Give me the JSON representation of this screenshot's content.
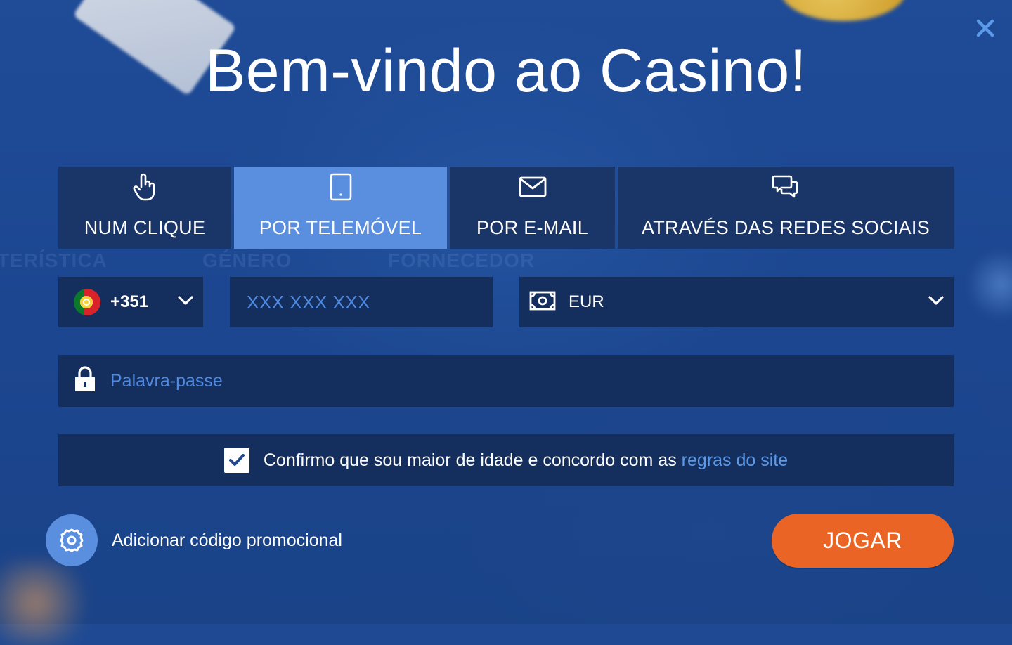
{
  "title": "Bem-vindo ao Casino!",
  "tabs": [
    {
      "label": "NUM CLIQUE",
      "icon": "hand-pointer-icon",
      "active": false
    },
    {
      "label": "POR TELEMÓVEL",
      "icon": "smartphone-icon",
      "active": true
    },
    {
      "label": "POR E-MAIL",
      "icon": "envelope-icon",
      "active": false
    },
    {
      "label": "ATRAVÉS DAS REDES SOCIAIS",
      "icon": "chat-bubbles-icon",
      "active": false
    }
  ],
  "phone": {
    "country_code": "+351",
    "country_flag": "portugal-flag-icon",
    "placeholder": "XXX XXX XXX"
  },
  "currency": {
    "selected": "EUR",
    "icon": "banknote-icon"
  },
  "password": {
    "placeholder": "Palavra-passe",
    "icon": "lock-icon"
  },
  "consent": {
    "checked": true,
    "text": "Confirmo que sou maior de idade e concordo com as ",
    "link_text": "regras do site"
  },
  "promo": {
    "label": "Adicionar código promocional",
    "icon": "gear-icon"
  },
  "submit": {
    "label": "JOGAR"
  },
  "background_text": [
    "TERÍSTICA",
    "GÉNERO",
    "FORNECEDOR"
  ],
  "colors": {
    "background": "#1f4a93",
    "field": "#142e5e",
    "tab": "#1a3567",
    "tab_active": "#5a8fe0",
    "accent_link": "#5b9ae8",
    "play_button": "#ea6525"
  }
}
